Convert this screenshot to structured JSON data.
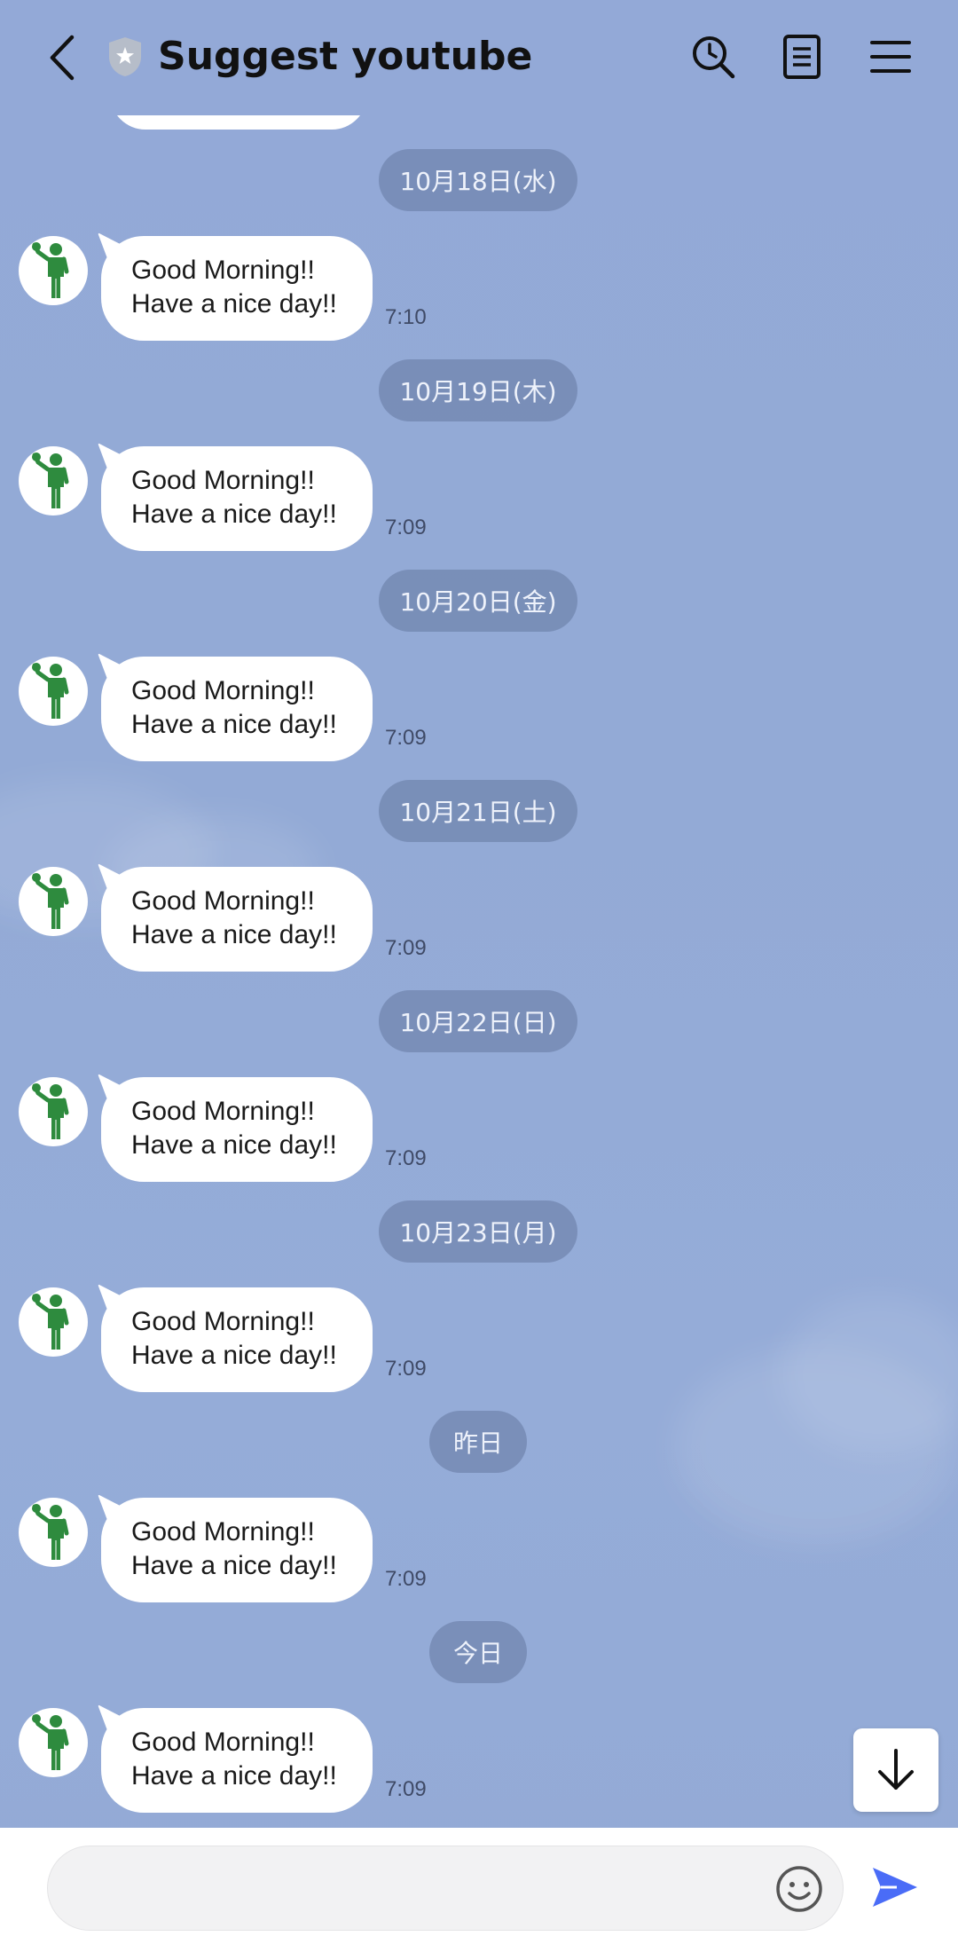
{
  "header": {
    "title": "Suggest youtube",
    "back_icon": "chevron-left-icon",
    "badge_icon": "shield-star-icon",
    "search_icon": "search-icon",
    "notes_icon": "notes-icon",
    "menu_icon": "menu-icon"
  },
  "colors": {
    "background": "#93aad6",
    "date_pill": "#7b8fb8",
    "bubble": "#ffffff",
    "avatar_figure": "#2e8b3e",
    "send_accent": "#4a6cf7"
  },
  "messages": [
    {
      "date": "10月18日(水)",
      "line1": "Good Morning!!",
      "line2": "Have a nice day!!",
      "time": "7:10"
    },
    {
      "date": "10月19日(木)",
      "line1": "Good Morning!!",
      "line2": "Have a nice day!!",
      "time": "7:09"
    },
    {
      "date": "10月20日(金)",
      "line1": "Good Morning!!",
      "line2": "Have a nice day!!",
      "time": "7:09"
    },
    {
      "date": "10月21日(土)",
      "line1": "Good Morning!!",
      "line2": "Have a nice day!!",
      "time": "7:09"
    },
    {
      "date": "10月22日(日)",
      "line1": "Good Morning!!",
      "line2": "Have a nice day!!",
      "time": "7:09"
    },
    {
      "date": "10月23日(月)",
      "line1": "Good Morning!!",
      "line2": "Have a nice day!!",
      "time": "7:09"
    },
    {
      "date": "昨日",
      "line1": "Good Morning!!",
      "line2": "Have a nice day!!",
      "time": "7:09"
    },
    {
      "date": "今日",
      "line1": "Good Morning!!",
      "line2": "Have a nice day!!",
      "time": "7:09"
    }
  ],
  "input": {
    "placeholder": "",
    "value": ""
  },
  "icons": {
    "scroll_down": "arrow-down-icon",
    "emoji": "smiley-icon",
    "send": "send-icon"
  }
}
